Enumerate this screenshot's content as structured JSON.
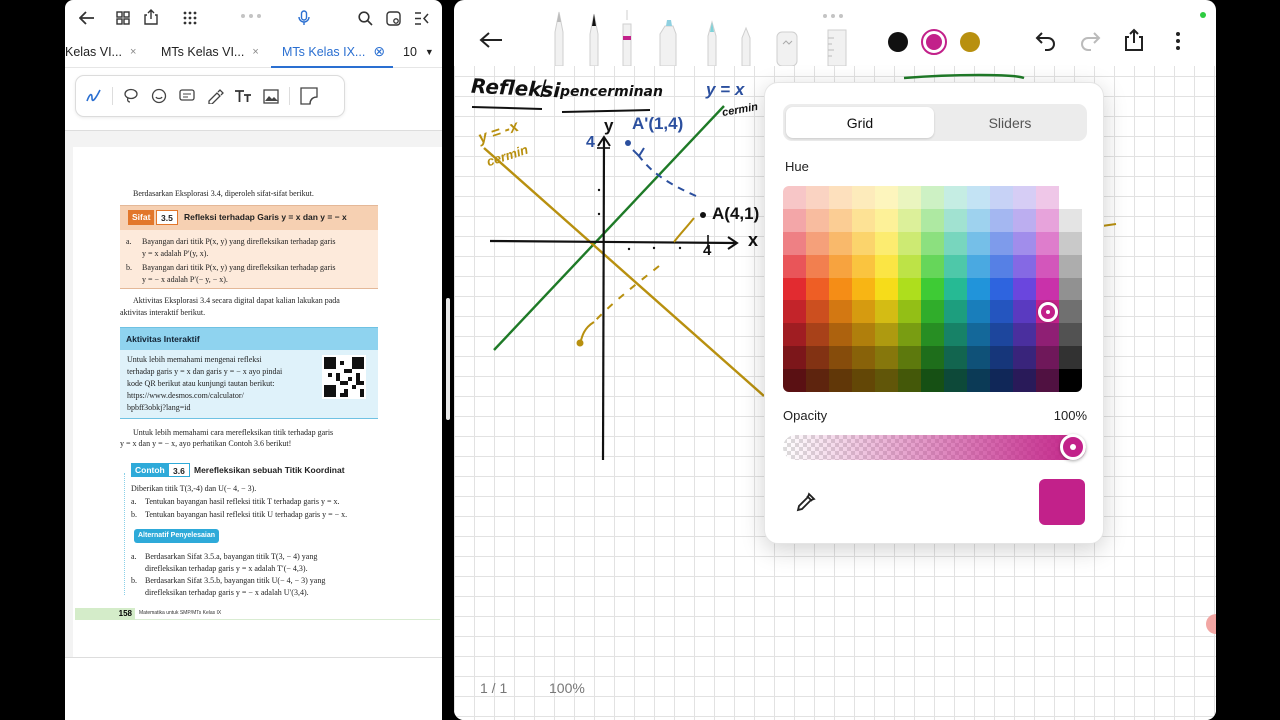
{
  "left_app": {
    "tabs": [
      {
        "label": "Kelas VI...",
        "close": "×"
      },
      {
        "label": "MTs Kelas VI...",
        "close": "×"
      },
      {
        "label": "MTs Kelas IX...",
        "close": "⊗"
      }
    ],
    "tab_count": "10",
    "document": {
      "intro": "Berdasarkan Eksplorasi 3.4, diperoleh sifat-sifat berikut.",
      "sifat": {
        "tag": "Sifat",
        "number": "3.5",
        "title": "Refleksi terhadap Garis y = x dan y = − x",
        "items": [
          {
            "marker": "a.",
            "line1": "Bayangan dari titik P(x, y) yang direfleksikan terhadap garis",
            "line2": "y = x adalah P′(y, x)."
          },
          {
            "marker": "b.",
            "line1": "Bayangan dari titik P(x, y) yang direfleksikan terhadap garis",
            "line2": "y = − x adalah P′(− y, − x)."
          }
        ]
      },
      "para1_line1": "Aktivitas Eksplorasi 3.4 secara digital dapat kalian lakukan pada",
      "para1_line2": "aktivitas interaktif berikut.",
      "aktivitas": {
        "title": "Aktivitas Interaktif",
        "lines": [
          "Untuk lebih memahami mengenai refleksi",
          "terhadap garis y = x dan garis y = − x ayo pindai",
          "kode QR berikut atau kunjungi tautan berikut:",
          "https://www.desmos.com/calculator/",
          "bpbff3obkj?lang=id"
        ]
      },
      "para2_line1": "Untuk lebih memahami cara merefleksikan titik terhadap garis",
      "para2_line2": "y = x dan y = − x, ayo perhatikan Contoh 3.6 berikut!",
      "contoh": {
        "tag": "Contoh",
        "number": "3.6",
        "title": "Merefleksikan sebuah Titik Koordinat",
        "given": "Diberikan titik T(3,-4) dan U(− 4, − 3).",
        "items": [
          {
            "marker": "a.",
            "text": "Tentukan bayangan hasil refleksi titik T terhadap garis y = x."
          },
          {
            "marker": "b.",
            "text": "Tentukan bayangan hasil refleksi titik U terhadap garis y = − x."
          }
        ],
        "alt_label": "Alternatif Penyelesaian",
        "answers": [
          {
            "marker": "a.",
            "line1": "Berdasarkan Sifat 3.5.a, bayangan titik T(3, − 4) yang",
            "line2": "direfleksikan terhadap garis y = x adalah T′(− 4,3)."
          },
          {
            "marker": "b.",
            "line1": "Berdasarkan Sifat 3.5.b, bayangan titik U(− 4, − 3) yang",
            "line2": "direfleksikan terhadap garis y = − x adalah U′(3,4)."
          }
        ]
      },
      "page_number": "158",
      "footer": "Matematika untuk SMP/MTs Kelas IX"
    }
  },
  "right_app": {
    "notes": {
      "title1": "Refleksi",
      "slash": "/",
      "title2": "pencerminan",
      "yx_green": "y = x",
      "yx_green2": "cermin",
      "yx_gold": "y = -x",
      "yx_gold2": "cermin",
      "axis_y": "y",
      "axis_x": "x",
      "tick_y": "4",
      "tick_x": "4",
      "point_a": "A(4,1)",
      "point_a_prime": "A'(1,4)"
    },
    "ink_colors": [
      "#111111",
      "#c2218a",
      "#b8900f"
    ],
    "picker": {
      "tab_grid": "Grid",
      "tab_sliders": "Sliders",
      "hue_label": "Hue",
      "opacity_label": "Opacity",
      "opacity_value": "100%",
      "selected_color": "#c2218a",
      "swatch_rows": [
        [
          "#f7c6c7",
          "#fad3c2",
          "#fde0bd",
          "#fdebbb",
          "#fdf5bd",
          "#eaf5bf",
          "#cdf1c4",
          "#c5ede3",
          "#c3e3f4",
          "#c7d2f6",
          "#d6cdf5",
          "#efc7e8",
          "#ffffff"
        ],
        [
          "#f3a6a8",
          "#f8bc9f",
          "#fbcd94",
          "#fde295",
          "#fdf198",
          "#dcf09a",
          "#aee9a2",
          "#a1e2d1",
          "#9ed2ee",
          "#a4b7f1",
          "#bcaef0",
          "#e7a3db",
          "#e4e4e4"
        ],
        [
          "#ee8084",
          "#f5a07a",
          "#f9b96b",
          "#fbd46c",
          "#fcec70",
          "#cdea73",
          "#8ce07f",
          "#78d6be",
          "#75bfe8",
          "#7e9beb",
          "#a18deb",
          "#de7dcc",
          "#c9c9c9"
        ],
        [
          "#e95559",
          "#f27f4f",
          "#f7a33f",
          "#fac43f",
          "#fbe544",
          "#bde347",
          "#66d65a",
          "#4ec8a9",
          "#4aa9e1",
          "#5680e5",
          "#8569e4",
          "#d356bb",
          "#adadad"
        ],
        [
          "#e22b30",
          "#ee5e25",
          "#f58d16",
          "#f8b514",
          "#f6dc1a",
          "#aede1d",
          "#3ecb35",
          "#26ba94",
          "#2194da",
          "#2e64df",
          "#6a46de",
          "#c931aa",
          "#919191"
        ],
        [
          "#c3242a",
          "#cc4f1f",
          "#d37812",
          "#d69b10",
          "#d4bc14",
          "#93bf16",
          "#30ad2b",
          "#1d9e7e",
          "#197ebb",
          "#2455bf",
          "#5a3ac0",
          "#c2218a",
          "#707070"
        ],
        [
          "#a01d22",
          "#a84119",
          "#ad620e",
          "#b07f0c",
          "#ae9a10",
          "#799d12",
          "#278e23",
          "#178267",
          "#14689a",
          "#1d469d",
          "#4a2f9e",
          "#8f1f74",
          "#525252"
        ],
        [
          "#7c161a",
          "#823213",
          "#864c0b",
          "#886209",
          "#86770c",
          "#5d790d",
          "#1e6e1b",
          "#12654f",
          "#0f5178",
          "#16367a",
          "#39247b",
          "#6f185a",
          "#323232"
        ],
        [
          "#5a1013",
          "#5e240e",
          "#613708",
          "#634706",
          "#615609",
          "#445809",
          "#165014",
          "#0d4939",
          "#0b3a56",
          "#102758",
          "#291a59",
          "#501141",
          "#000000"
        ]
      ]
    },
    "status": {
      "page": "1 / 1",
      "zoom": "100%"
    }
  }
}
